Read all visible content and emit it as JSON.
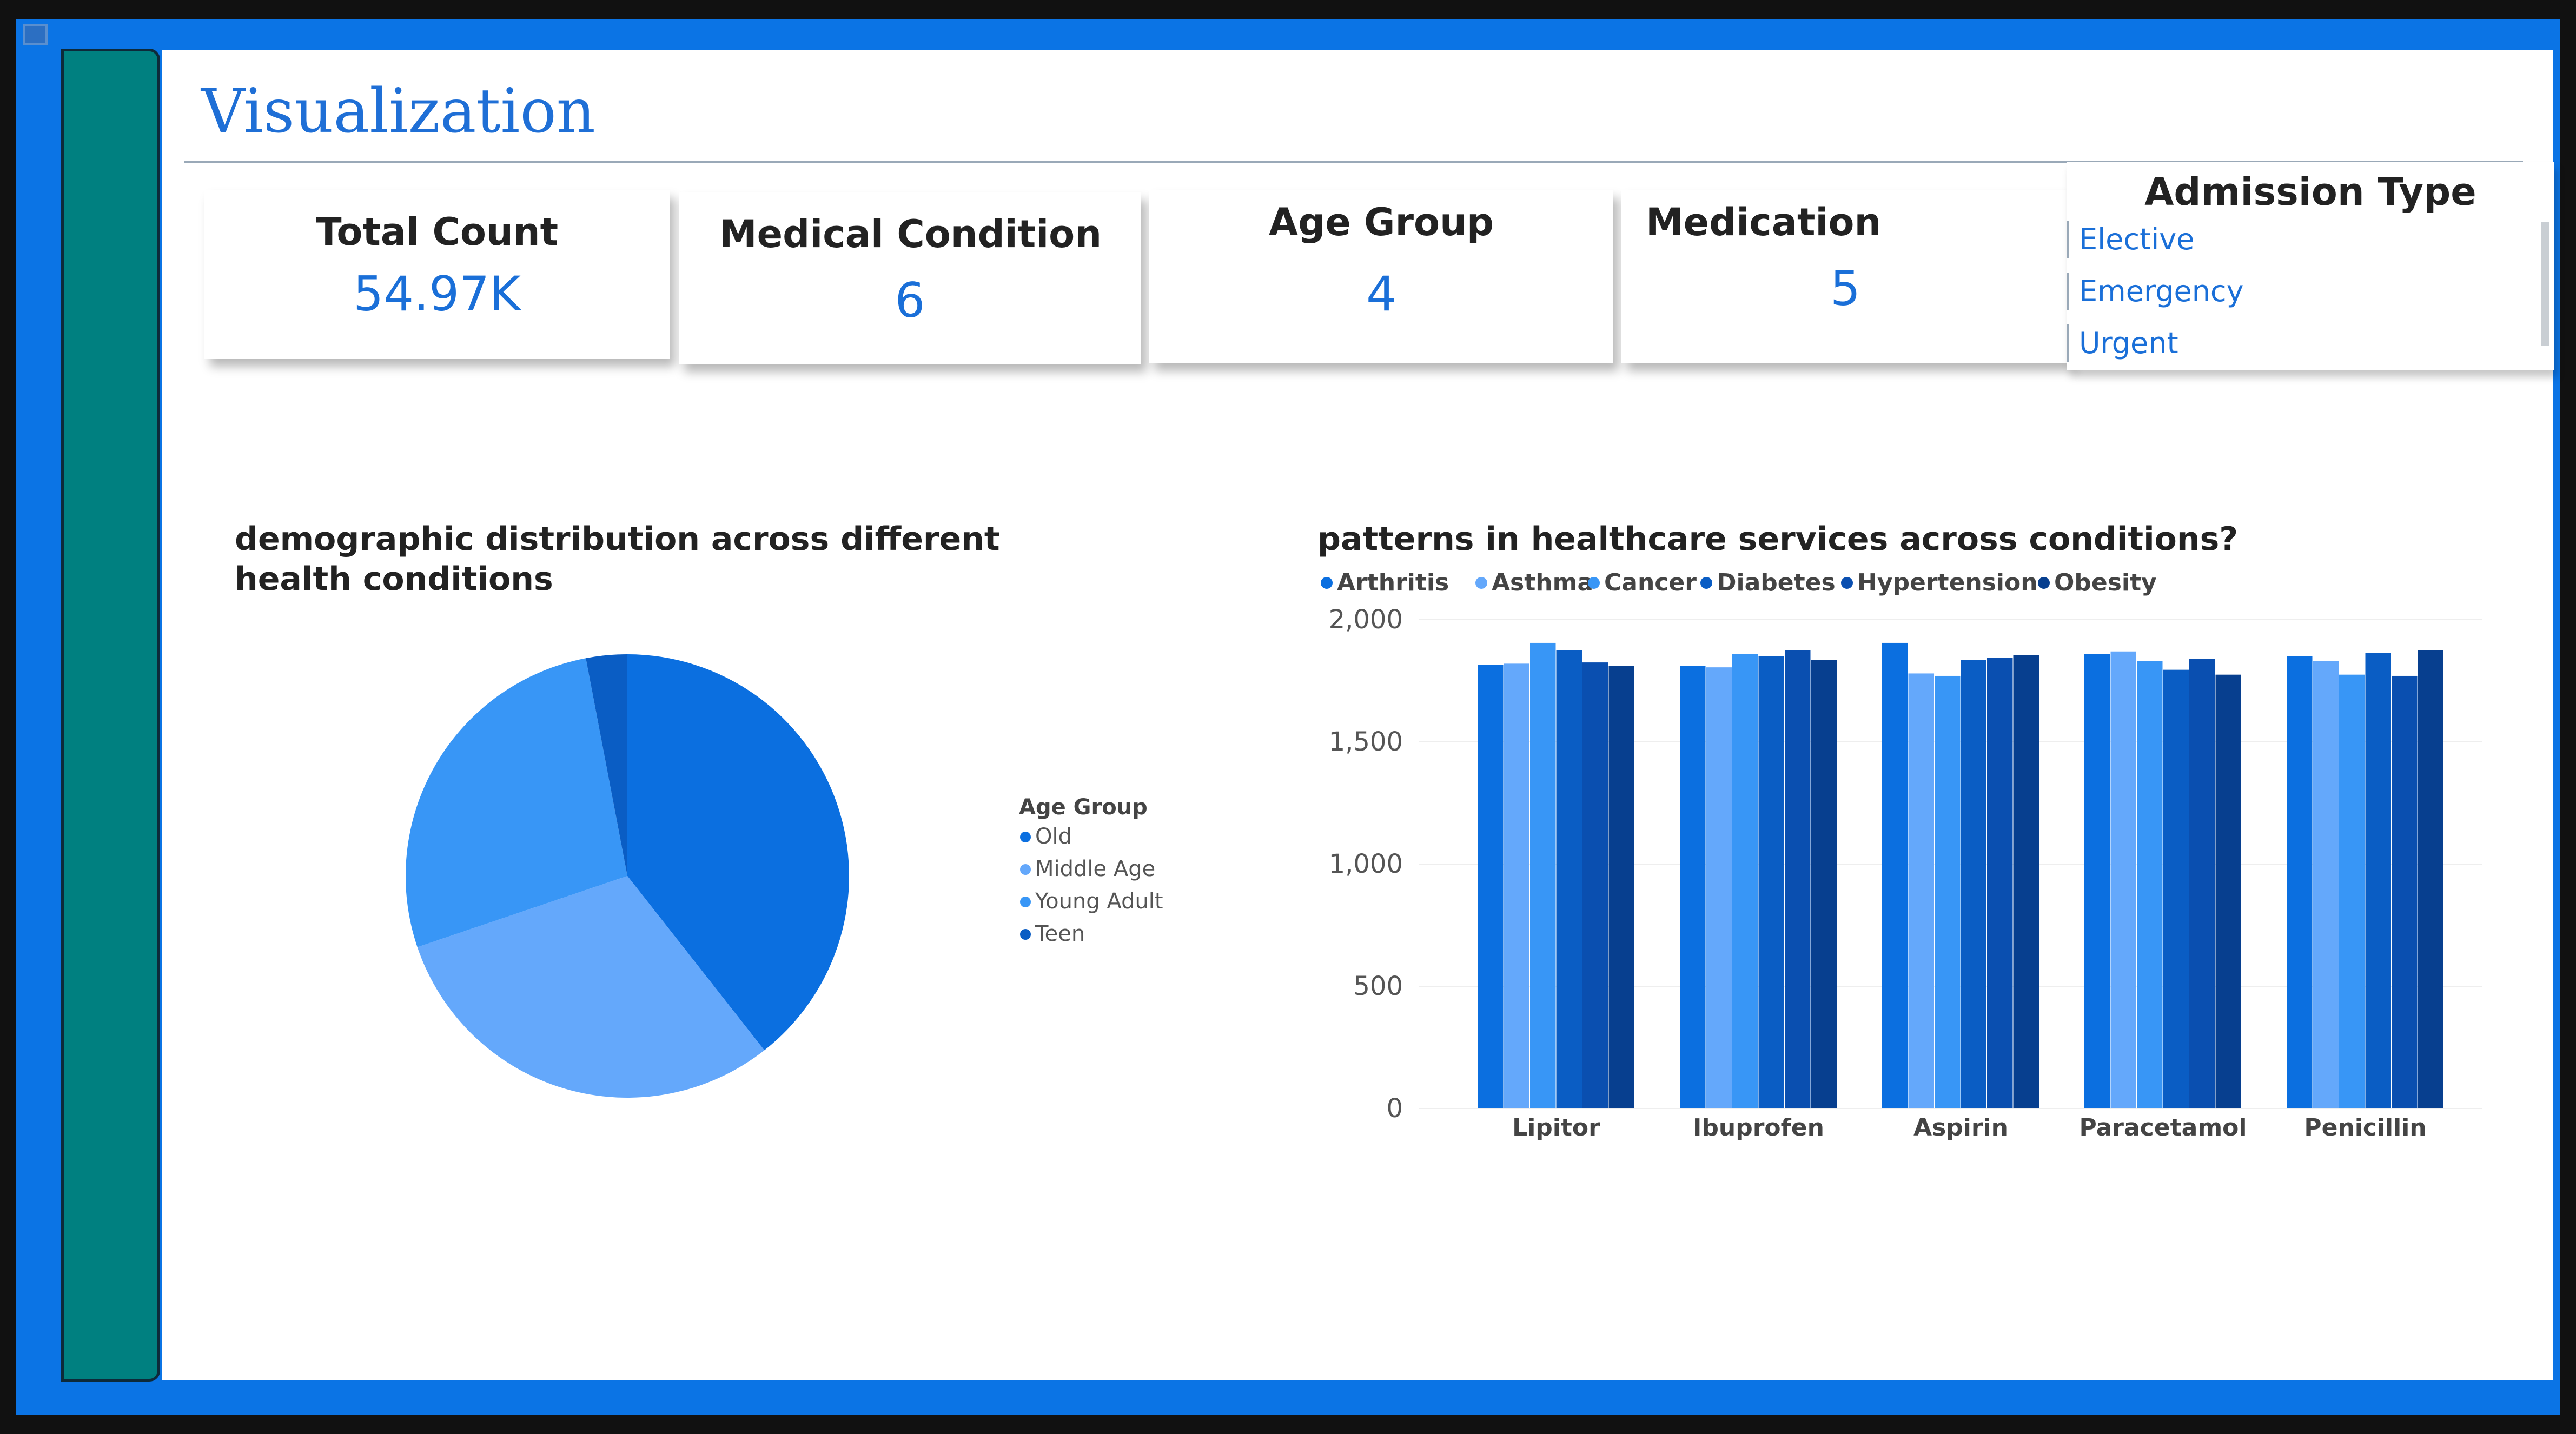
{
  "page": {
    "title": "Visualization"
  },
  "cards": {
    "total_count": {
      "label": "Total Count",
      "value": "54.97K"
    },
    "medical_condition": {
      "label": "Medical Condition",
      "value": "6"
    },
    "age_group": {
      "label": "Age Group",
      "value": "4"
    },
    "medication": {
      "label": "Medication",
      "value": "5"
    }
  },
  "slicer": {
    "title": "Admission Type",
    "items": [
      "Elective",
      "Emergency",
      "Urgent"
    ]
  },
  "pie": {
    "title": "demographic distribution across different health conditions",
    "legend_title": "Age Group"
  },
  "bar": {
    "title": "patterns in healthcare services across conditions?"
  },
  "colors": {
    "accent": "#1a6fd8",
    "frame": "#0b74e5",
    "sidebar": "#008080",
    "old": "#0b6fe0",
    "middle_age": "#64a8fb",
    "young_adult": "#3896f6",
    "teen": "#0a5dc4",
    "arthritis": "#0b6fe0",
    "asthma": "#64a8fb",
    "cancer": "#3896f6",
    "diabetes": "#0a5dc4",
    "hypertension": "#0a4fb0",
    "obesity": "#073f8f"
  },
  "chart_data": [
    {
      "type": "pie",
      "title": "demographic distribution across different health conditions",
      "legend_title": "Age Group",
      "legend_position": "right",
      "categories": [
        "Old",
        "Middle Age",
        "Young Adult",
        "Teen"
      ],
      "values": [
        39.4,
        30.4,
        27.2,
        3.0
      ]
    },
    {
      "type": "bar",
      "title": "patterns in healthcare services across conditions?",
      "legend_position": "top",
      "categories": [
        "Lipitor",
        "Ibuprofen",
        "Aspirin",
        "Paracetamol",
        "Penicillin"
      ],
      "series": [
        {
          "name": "Arthritis",
          "values": [
            1815,
            1810,
            1905,
            1860,
            1850
          ]
        },
        {
          "name": "Asthma",
          "values": [
            1820,
            1805,
            1780,
            1870,
            1830
          ]
        },
        {
          "name": "Cancer",
          "values": [
            1905,
            1860,
            1770,
            1830,
            1775
          ]
        },
        {
          "name": "Diabetes",
          "values": [
            1875,
            1850,
            1835,
            1795,
            1865
          ]
        },
        {
          "name": "Hypertension",
          "values": [
            1825,
            1875,
            1845,
            1840,
            1770
          ]
        },
        {
          "name": "Obesity",
          "values": [
            1810,
            1835,
            1855,
            1775,
            1875
          ]
        }
      ],
      "yticks": [
        "0",
        "500",
        "1,000",
        "1,500",
        "2,000"
      ],
      "ylim": [
        0,
        2000
      ],
      "grid": true
    }
  ]
}
